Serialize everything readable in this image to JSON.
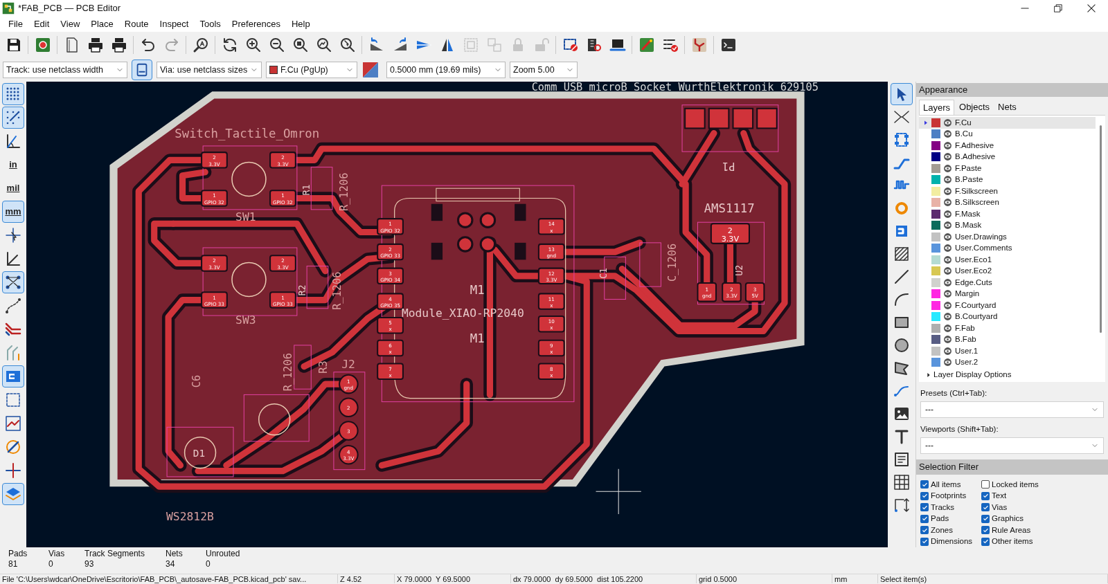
{
  "window": {
    "title": "*FAB_PCB — PCB Editor"
  },
  "menu": [
    "File",
    "Edit",
    "View",
    "Place",
    "Route",
    "Inspect",
    "Tools",
    "Preferences",
    "Help"
  ],
  "top_toolbar": [
    {
      "disabled": false
    },
    {
      "disabled": false
    },
    {
      "disabled": false
    },
    {
      "disabled": false
    },
    {
      "disabled": false
    },
    {
      "disabled": false
    },
    {
      "disabled": true
    },
    {
      "disabled": false
    },
    {
      "disabled": false
    },
    {
      "disabled": false
    },
    {
      "disabled": false
    },
    {
      "disabled": false
    },
    {
      "disabled": false
    },
    {
      "disabled": false
    },
    {
      "disabled": false
    },
    {
      "disabled": false
    },
    {
      "disabled": false
    },
    {
      "disabled": false
    },
    {
      "disabled": true
    },
    {
      "disabled": true
    },
    {
      "disabled": true
    },
    {
      "disabled": true
    },
    {
      "disabled": false
    },
    {
      "disabled": false
    },
    {
      "disabled": false
    },
    {
      "disabled": false
    },
    {
      "disabled": false
    },
    {
      "disabled": false
    },
    {
      "disabled": false
    }
  ],
  "options_bar": {
    "track": "Track: use netclass width",
    "auto_width": {
      "selected": true
    },
    "via": "Via: use netclass sizes",
    "layer": {
      "label": "F.Cu (PgUp)",
      "color": "#c83434"
    },
    "grid": "0.5000 mm (19.69 mils)",
    "zoom": "Zoom 5.00"
  },
  "left_toolbar": [
    {
      "kind": "icon",
      "selected": true
    },
    {
      "kind": "icon",
      "selected": true
    },
    {
      "kind": "icon",
      "selected": false
    },
    {
      "kind": "text",
      "label": "in",
      "selected": false
    },
    {
      "kind": "text",
      "label": "mil",
      "selected": false
    },
    {
      "kind": "text",
      "label": "mm",
      "selected": true
    },
    {
      "kind": "icon",
      "selected": false
    },
    {
      "kind": "icon",
      "selected": false
    },
    {
      "kind": "icon",
      "selected": true
    },
    {
      "kind": "icon",
      "selected": false
    },
    {
      "kind": "icon",
      "selected": false
    },
    {
      "kind": "icon",
      "selected": false
    },
    {
      "kind": "icon",
      "selected": true
    },
    {
      "kind": "icon",
      "selected": false
    },
    {
      "kind": "icon",
      "selected": false
    },
    {
      "kind": "icon",
      "selected": false
    },
    {
      "kind": "icon",
      "selected": false
    },
    {
      "kind": "icon",
      "selected": true
    }
  ],
  "right_toolbar": [
    {
      "selected": true
    },
    {
      "selected": false
    },
    {
      "selected": false
    },
    {
      "selected": false
    },
    {
      "selected": false
    },
    {
      "selected": false
    },
    {
      "selected": false
    },
    {
      "selected": false
    },
    {
      "selected": false
    },
    {
      "selected": false
    },
    {
      "selected": false
    },
    {
      "selected": false
    },
    {
      "selected": false
    },
    {
      "selected": false
    },
    {
      "selected": false
    },
    {
      "selected": false
    },
    {
      "selected": false
    },
    {
      "selected": false
    },
    {
      "selected": false
    }
  ],
  "pcb": {
    "labels": [
      "Comm_USB_microB_Socket_WurthElektronik_629105",
      "Switch_Tactile_Omron",
      "SW1",
      "SW3",
      "M1",
      "Module_XIAO-RP2040",
      "M1",
      "AMS1117",
      "WS2812B",
      "J2",
      "D1",
      "C6",
      "R3",
      "R1",
      "R2",
      "U2",
      "C1",
      "R_1206",
      "R_1206",
      "R_1206",
      "C_1206",
      "P1"
    ],
    "pads": [
      {
        "number": "2",
        "net": "3.3V"
      },
      {
        "number": "2",
        "net": "3.3V"
      },
      {
        "number": "1",
        "net": "GPIO 32"
      },
      {
        "number": "1",
        "net": "GPIO 32"
      },
      {
        "number": "2",
        "net": "3.3V"
      },
      {
        "number": "2",
        "net": "3.3V"
      },
      {
        "number": "1",
        "net": "GPIO 33"
      },
      {
        "number": "1",
        "net": "GPIO 33"
      },
      {
        "number": "1",
        "net": "GPIO 32"
      },
      {
        "number": "2",
        "net": "GPIO 33"
      },
      {
        "number": "3",
        "net": "GPIO 34"
      },
      {
        "number": "4",
        "net": "GPIO 35"
      },
      {
        "number": "5",
        "net": "x"
      },
      {
        "number": "6",
        "net": "x"
      },
      {
        "number": "7",
        "net": "x"
      },
      {
        "number": "14",
        "net": "x"
      },
      {
        "number": "13",
        "net": "gnd"
      },
      {
        "number": "12",
        "net": "3.3V"
      },
      {
        "number": "11",
        "net": "x"
      },
      {
        "number": "10",
        "net": "x"
      },
      {
        "number": "9",
        "net": "x"
      },
      {
        "number": "8",
        "net": "x"
      },
      {
        "number": "2",
        "net": "3.3V"
      },
      {
        "number": "1",
        "net": "gnd"
      },
      {
        "number": "2",
        "net": "3.3V"
      },
      {
        "number": "3",
        "net": "5V"
      },
      {
        "number": "1",
        "net": "gnd"
      },
      {
        "number": "2"
      },
      {
        "number": "3"
      },
      {
        "number": "4",
        "net": "3.3V"
      }
    ]
  },
  "appearance": {
    "title": "Appearance",
    "tabs": [
      {
        "label": "Layers",
        "selected": true
      },
      {
        "label": "Objects",
        "selected": false
      },
      {
        "label": "Nets",
        "selected": false
      }
    ],
    "layers": [
      {
        "name": "F.Cu",
        "color": "#c83434",
        "visible": true,
        "selected": true
      },
      {
        "name": "B.Cu",
        "color": "#4d7fc4",
        "visible": true,
        "selected": false
      },
      {
        "name": "F.Adhesive",
        "color": "#840084",
        "visible": true,
        "selected": false
      },
      {
        "name": "B.Adhesive",
        "color": "#000084",
        "visible": true,
        "selected": false
      },
      {
        "name": "F.Paste",
        "color": "#a39c94",
        "visible": true,
        "selected": false
      },
      {
        "name": "B.Paste",
        "color": "#00b2ac",
        "visible": true,
        "selected": false
      },
      {
        "name": "F.Silkscreen",
        "color": "#f2eda1",
        "visible": true,
        "selected": false
      },
      {
        "name": "B.Silkscreen",
        "color": "#e8b2a7",
        "visible": true,
        "selected": false
      },
      {
        "name": "F.Mask",
        "color": "#5c2a6e",
        "visible": true,
        "selected": false
      },
      {
        "name": "B.Mask",
        "color": "#0b6b5c",
        "visible": true,
        "selected": false
      },
      {
        "name": "User.Drawings",
        "color": "#c2c2c2",
        "visible": true,
        "selected": false
      },
      {
        "name": "User.Comments",
        "color": "#5994dc",
        "visible": true,
        "selected": false
      },
      {
        "name": "User.Eco1",
        "color": "#b4dbd2",
        "visible": true,
        "selected": false
      },
      {
        "name": "User.Eco2",
        "color": "#d8c852",
        "visible": true,
        "selected": false
      },
      {
        "name": "Edge.Cuts",
        "color": "#d0d2cd",
        "visible": true,
        "selected": false
      },
      {
        "name": "Margin",
        "color": "#ff26e2",
        "visible": true,
        "selected": false
      },
      {
        "name": "F.Courtyard",
        "color": "#ff26e2",
        "visible": true,
        "selected": false
      },
      {
        "name": "B.Courtyard",
        "color": "#26e9ff",
        "visible": true,
        "selected": false
      },
      {
        "name": "F.Fab",
        "color": "#afafaf",
        "visible": true,
        "selected": false
      },
      {
        "name": "B.Fab",
        "color": "#585d84",
        "visible": true,
        "selected": false
      },
      {
        "name": "User.1",
        "color": "#c2c2c2",
        "visible": true,
        "selected": false
      },
      {
        "name": "User.2",
        "color": "#5994dc",
        "visible": true,
        "selected": false
      }
    ],
    "display_options": "Layer Display Options",
    "presets": {
      "label": "Presets (Ctrl+Tab):",
      "value": "---"
    },
    "viewports": {
      "label": "Viewports (Shift+Tab):",
      "value": "---"
    }
  },
  "selection_filter": {
    "title": "Selection Filter",
    "items": [
      {
        "label": "All items",
        "checked": true
      },
      {
        "label": "Locked items",
        "checked": false
      },
      {
        "label": "Footprints",
        "checked": true
      },
      {
        "label": "Text",
        "checked": true
      },
      {
        "label": "Tracks",
        "checked": true
      },
      {
        "label": "Vias",
        "checked": true
      },
      {
        "label": "Pads",
        "checked": true
      },
      {
        "label": "Graphics",
        "checked": true
      },
      {
        "label": "Zones",
        "checked": true
      },
      {
        "label": "Rule Areas",
        "checked": true
      },
      {
        "label": "Dimensions",
        "checked": true
      },
      {
        "label": "Other items",
        "checked": true
      }
    ]
  },
  "stats": [
    {
      "label": "Pads",
      "value": "81"
    },
    {
      "label": "Vias",
      "value": "0"
    },
    {
      "label": "Track Segments",
      "value": "93"
    },
    {
      "label": "Nets",
      "value": "34"
    },
    {
      "label": "Unrouted",
      "value": "0"
    }
  ],
  "status_bar": [
    "File 'C:\\Users\\wdcar\\OneDrive\\Escritorio\\FAB_PCB\\_autosave-FAB_PCB.kicad_pcb' sav...",
    "Z 4.52",
    "X 79.0000  Y 69.5000",
    "dx 79.0000  dy 69.5000  dist 105.2200",
    "grid 0.5000",
    "mm",
    "Select item(s)"
  ]
}
